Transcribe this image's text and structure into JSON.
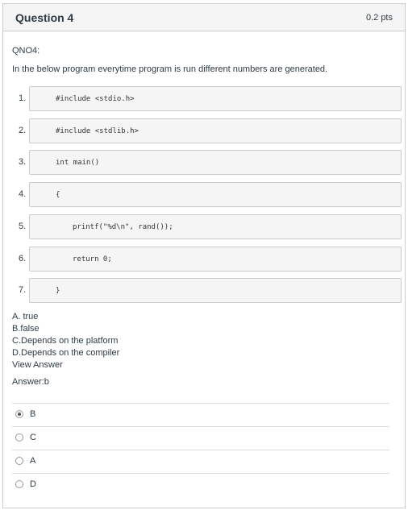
{
  "header": {
    "title": "Question 4",
    "points": "0.2 pts"
  },
  "question": {
    "qno": "QNO4:",
    "intro": "In the below program everytime program is run different numbers are generated.",
    "code_lines": [
      {
        "num": "1.",
        "code": "#include <stdio.h>",
        "indent": 0
      },
      {
        "num": "2.",
        "code": "#include <stdlib.h>",
        "indent": 0
      },
      {
        "num": "3.",
        "code": "int main()",
        "indent": 0
      },
      {
        "num": "4.",
        "code": "{",
        "indent": 0
      },
      {
        "num": "5.",
        "code": "printf(\"%d\\n\", rand());",
        "indent": 1
      },
      {
        "num": "6.",
        "code": "return 0;",
        "indent": 1
      },
      {
        "num": "7.",
        "code": "}",
        "indent": 0
      }
    ],
    "options": [
      "A. true",
      "B.false",
      "C.Depends on the platform",
      "D.Depends on the compiler",
      "View Answer"
    ],
    "answer": "Answer:b"
  },
  "choices": [
    {
      "label": "B",
      "selected": true
    },
    {
      "label": "C",
      "selected": false
    },
    {
      "label": "A",
      "selected": false
    },
    {
      "label": "D",
      "selected": false
    }
  ]
}
